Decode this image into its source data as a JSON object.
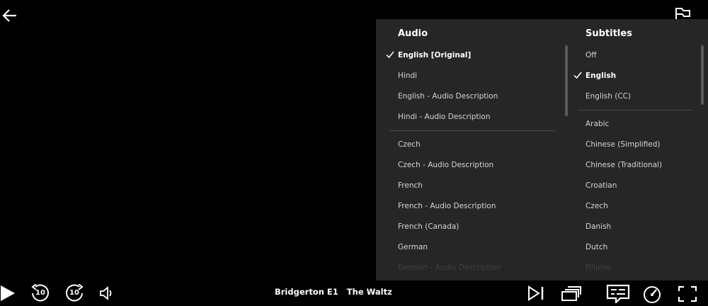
{
  "audio": {
    "title": "Audio",
    "items": [
      {
        "label": "English [Original]",
        "selected": true
      },
      {
        "label": "Hindi"
      },
      {
        "label": "English - Audio Description"
      },
      {
        "label": "Hindi - Audio Description"
      },
      {
        "label": "Czech"
      },
      {
        "label": "Czech - Audio Description"
      },
      {
        "label": "French"
      },
      {
        "label": "French - Audio Description"
      },
      {
        "label": "French (Canada)"
      },
      {
        "label": "German"
      },
      {
        "label": "German - Audio Description"
      }
    ]
  },
  "subtitles": {
    "title": "Subtitles",
    "items": [
      {
        "label": "Off"
      },
      {
        "label": "English",
        "selected": true
      },
      {
        "label": "English (CC)"
      },
      {
        "label": "Arabic"
      },
      {
        "label": "Chinese (Simplified)"
      },
      {
        "label": "Chinese (Traditional)"
      },
      {
        "label": "Croatian"
      },
      {
        "label": "Czech"
      },
      {
        "label": "Danish"
      },
      {
        "label": "Dutch"
      },
      {
        "label": "Filipino"
      }
    ]
  },
  "player": {
    "show": "Bridgerton",
    "episode": "E1",
    "episode_title": "The Waltz",
    "skip_back_seconds": "10",
    "skip_forward_seconds": "10"
  },
  "colors": {
    "background": "#000000",
    "panel": "#262626",
    "text": "#ffffff",
    "muted_text": "#d6d6d6"
  }
}
